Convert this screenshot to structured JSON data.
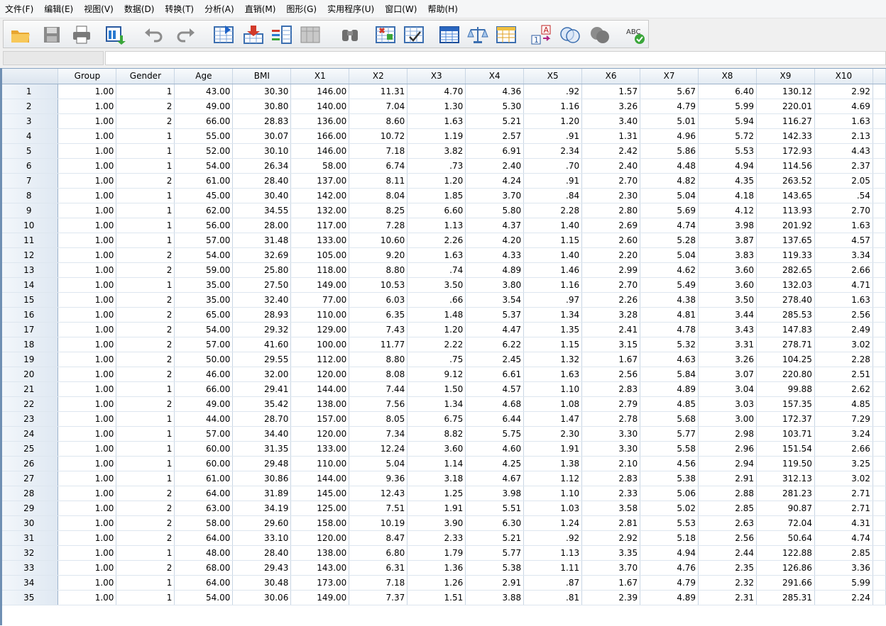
{
  "menu": [
    "文件(F)",
    "编辑(E)",
    "视图(V)",
    "数据(D)",
    "转换(T)",
    "分析(A)",
    "直销(M)",
    "图形(G)",
    "实用程序(U)",
    "窗口(W)",
    "帮助(H)"
  ],
  "toolbar": {
    "icons": [
      "open-folder-icon",
      "save-icon",
      "print-icon",
      "dialog-recall-icon",
      "undo-icon",
      "redo-icon",
      "goto-case-icon",
      "goto-variable-icon",
      "variables-icon",
      "run-descriptives-icon",
      "find-icon",
      "insert-cases-icon",
      "insert-variable-icon",
      "split-file-icon",
      "weight-cases-icon",
      "select-cases-icon",
      "value-labels-icon",
      "use-sets-icon",
      "show-all-variables-icon",
      "spell-check-icon"
    ],
    "spell_label": "ABC"
  },
  "editor": {
    "cell_ref": "",
    "cell_value": ""
  },
  "grid": {
    "columns": [
      "Group",
      "Gender",
      "Age",
      "BMI",
      "X1",
      "X2",
      "X3",
      "X4",
      "X5",
      "X6",
      "X7",
      "X8",
      "X9",
      "X10"
    ],
    "rows": [
      [
        "1.00",
        "1",
        "43.00",
        "30.30",
        "146.00",
        "11.31",
        "4.70",
        "4.36",
        ".92",
        "1.57",
        "5.67",
        "6.40",
        "130.12",
        "2.92"
      ],
      [
        "1.00",
        "2",
        "49.00",
        "30.80",
        "140.00",
        "7.04",
        "1.30",
        "5.30",
        "1.16",
        "3.26",
        "4.79",
        "5.99",
        "220.01",
        "4.69"
      ],
      [
        "1.00",
        "2",
        "66.00",
        "28.83",
        "136.00",
        "8.60",
        "1.63",
        "5.21",
        "1.20",
        "3.40",
        "5.01",
        "5.94",
        "116.27",
        "1.63"
      ],
      [
        "1.00",
        "1",
        "55.00",
        "30.07",
        "166.00",
        "10.72",
        "1.19",
        "2.57",
        ".91",
        "1.31",
        "4.96",
        "5.72",
        "142.33",
        "2.13"
      ],
      [
        "1.00",
        "1",
        "52.00",
        "30.10",
        "146.00",
        "7.18",
        "3.82",
        "6.91",
        "2.34",
        "2.42",
        "5.86",
        "5.53",
        "172.93",
        "4.43"
      ],
      [
        "1.00",
        "1",
        "54.00",
        "26.34",
        "58.00",
        "6.74",
        ".73",
        "2.40",
        ".70",
        "2.40",
        "4.48",
        "4.94",
        "114.56",
        "2.37"
      ],
      [
        "1.00",
        "2",
        "61.00",
        "28.40",
        "137.00",
        "8.11",
        "1.20",
        "4.24",
        ".91",
        "2.70",
        "4.82",
        "4.35",
        "263.52",
        "2.05"
      ],
      [
        "1.00",
        "1",
        "45.00",
        "30.40",
        "142.00",
        "8.04",
        "1.85",
        "3.70",
        ".84",
        "2.30",
        "5.04",
        "4.18",
        "143.65",
        ".54"
      ],
      [
        "1.00",
        "1",
        "62.00",
        "34.55",
        "132.00",
        "8.25",
        "6.60",
        "5.80",
        "2.28",
        "2.80",
        "5.69",
        "4.12",
        "113.93",
        "2.70"
      ],
      [
        "1.00",
        "1",
        "56.00",
        "28.00",
        "117.00",
        "7.28",
        "1.13",
        "4.37",
        "1.40",
        "2.69",
        "4.74",
        "3.98",
        "201.92",
        "1.63"
      ],
      [
        "1.00",
        "1",
        "57.00",
        "31.48",
        "133.00",
        "10.60",
        "2.26",
        "4.20",
        "1.15",
        "2.60",
        "5.28",
        "3.87",
        "137.65",
        "4.57"
      ],
      [
        "1.00",
        "2",
        "54.00",
        "32.69",
        "105.00",
        "9.20",
        "1.63",
        "4.33",
        "1.40",
        "2.20",
        "5.04",
        "3.83",
        "119.33",
        "3.34"
      ],
      [
        "1.00",
        "2",
        "59.00",
        "25.80",
        "118.00",
        "8.80",
        ".74",
        "4.89",
        "1.46",
        "2.99",
        "4.62",
        "3.60",
        "282.65",
        "2.66"
      ],
      [
        "1.00",
        "1",
        "35.00",
        "27.50",
        "149.00",
        "10.53",
        "3.50",
        "3.80",
        "1.16",
        "2.70",
        "5.49",
        "3.60",
        "132.03",
        "4.71"
      ],
      [
        "1.00",
        "2",
        "35.00",
        "32.40",
        "77.00",
        "6.03",
        ".66",
        "3.54",
        ".97",
        "2.26",
        "4.38",
        "3.50",
        "278.40",
        "1.63"
      ],
      [
        "1.00",
        "2",
        "65.00",
        "28.93",
        "110.00",
        "6.35",
        "1.48",
        "5.37",
        "1.34",
        "3.28",
        "4.81",
        "3.44",
        "285.53",
        "2.56"
      ],
      [
        "1.00",
        "2",
        "54.00",
        "29.32",
        "129.00",
        "7.43",
        "1.20",
        "4.47",
        "1.35",
        "2.41",
        "4.78",
        "3.43",
        "147.83",
        "2.49"
      ],
      [
        "1.00",
        "2",
        "57.00",
        "41.60",
        "100.00",
        "11.77",
        "2.22",
        "6.22",
        "1.15",
        "3.15",
        "5.32",
        "3.31",
        "278.71",
        "3.02"
      ],
      [
        "1.00",
        "2",
        "50.00",
        "29.55",
        "112.00",
        "8.80",
        ".75",
        "2.45",
        "1.32",
        "1.67",
        "4.63",
        "3.26",
        "104.25",
        "2.28"
      ],
      [
        "1.00",
        "2",
        "46.00",
        "32.00",
        "120.00",
        "8.08",
        "9.12",
        "6.61",
        "1.63",
        "2.56",
        "5.84",
        "3.07",
        "220.80",
        "2.51"
      ],
      [
        "1.00",
        "1",
        "66.00",
        "29.41",
        "144.00",
        "7.44",
        "1.50",
        "4.57",
        "1.10",
        "2.83",
        "4.89",
        "3.04",
        "99.88",
        "2.62"
      ],
      [
        "1.00",
        "2",
        "49.00",
        "35.42",
        "138.00",
        "7.56",
        "1.34",
        "4.68",
        "1.08",
        "2.79",
        "4.85",
        "3.03",
        "157.35",
        "4.85"
      ],
      [
        "1.00",
        "1",
        "44.00",
        "28.70",
        "157.00",
        "8.05",
        "6.75",
        "6.44",
        "1.47",
        "2.78",
        "5.68",
        "3.00",
        "172.37",
        "7.29"
      ],
      [
        "1.00",
        "1",
        "57.00",
        "34.40",
        "120.00",
        "7.34",
        "8.82",
        "5.75",
        "2.30",
        "3.30",
        "5.77",
        "2.98",
        "103.71",
        "3.24"
      ],
      [
        "1.00",
        "1",
        "60.00",
        "31.35",
        "133.00",
        "12.24",
        "3.60",
        "4.60",
        "1.91",
        "3.30",
        "5.58",
        "2.96",
        "151.54",
        "2.66"
      ],
      [
        "1.00",
        "1",
        "60.00",
        "29.48",
        "110.00",
        "5.04",
        "1.14",
        "4.25",
        "1.38",
        "2.10",
        "4.56",
        "2.94",
        "119.50",
        "3.25"
      ],
      [
        "1.00",
        "1",
        "61.00",
        "30.86",
        "144.00",
        "9.36",
        "3.18",
        "4.67",
        "1.12",
        "2.83",
        "5.38",
        "2.91",
        "312.13",
        "3.02"
      ],
      [
        "1.00",
        "2",
        "64.00",
        "31.89",
        "145.00",
        "12.43",
        "1.25",
        "3.98",
        "1.10",
        "2.33",
        "5.06",
        "2.88",
        "281.23",
        "2.71"
      ],
      [
        "1.00",
        "2",
        "63.00",
        "34.19",
        "125.00",
        "7.51",
        "1.91",
        "5.51",
        "1.03",
        "3.58",
        "5.02",
        "2.85",
        "90.87",
        "2.71"
      ],
      [
        "1.00",
        "2",
        "58.00",
        "29.60",
        "158.00",
        "10.19",
        "3.90",
        "6.30",
        "1.24",
        "2.81",
        "5.53",
        "2.63",
        "72.04",
        "4.31"
      ],
      [
        "1.00",
        "2",
        "64.00",
        "33.10",
        "120.00",
        "8.47",
        "2.33",
        "5.21",
        ".92",
        "2.92",
        "5.18",
        "2.56",
        "50.64",
        "4.74"
      ],
      [
        "1.00",
        "1",
        "48.00",
        "28.40",
        "138.00",
        "6.80",
        "1.79",
        "5.77",
        "1.13",
        "3.35",
        "4.94",
        "2.44",
        "122.88",
        "2.85"
      ],
      [
        "1.00",
        "2",
        "68.00",
        "29.43",
        "143.00",
        "6.31",
        "1.36",
        "5.38",
        "1.11",
        "3.70",
        "4.76",
        "2.35",
        "126.86",
        "3.36"
      ],
      [
        "1.00",
        "1",
        "64.00",
        "30.48",
        "173.00",
        "7.18",
        "1.26",
        "2.91",
        ".87",
        "1.67",
        "4.79",
        "2.32",
        "291.66",
        "5.99"
      ],
      [
        "1.00",
        "1",
        "54.00",
        "30.06",
        "149.00",
        "7.37",
        "1.51",
        "3.88",
        ".81",
        "2.39",
        "4.89",
        "2.31",
        "285.31",
        "2.24"
      ]
    ]
  }
}
